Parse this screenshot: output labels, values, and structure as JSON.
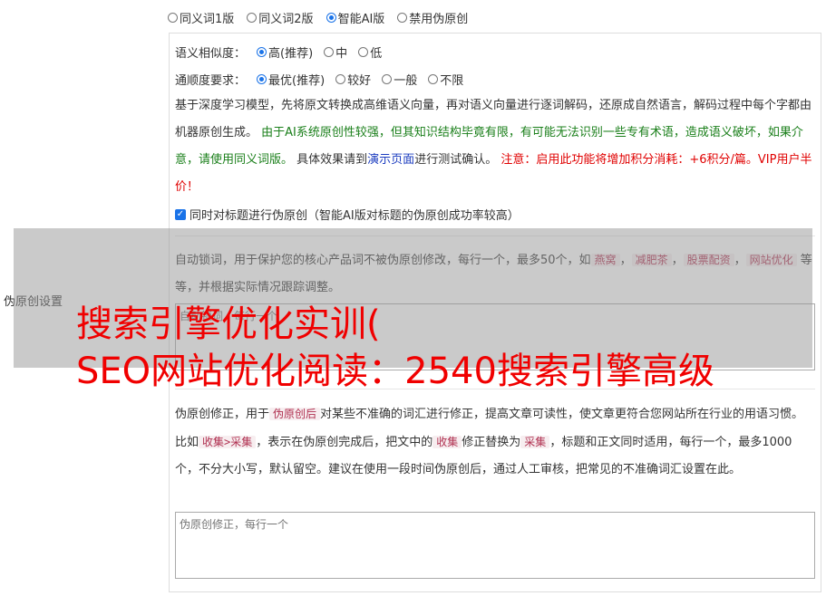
{
  "modes": {
    "options": [
      "同义词1版",
      "同义词2版",
      "智能AI版",
      "禁用伪原创"
    ],
    "selected_index": 2
  },
  "similarity": {
    "label": "语义相似度：",
    "options": [
      "高(推荐)",
      "中",
      "低"
    ],
    "selected_index": 0
  },
  "fluency": {
    "label": "通顺度要求：",
    "options": [
      "最优(推荐)",
      "较好",
      "一般",
      "不限"
    ],
    "selected_index": 0
  },
  "ai_desc": {
    "part1": "基于深度学习模型，先将原文转换成高维语义向量，再对语义向量进行逐词解码，还原成自然语言，解码过程中每个字都由机器原创生成。",
    "green": "由于AI系统原创性较强，但其知识结构毕竟有限，有可能无法识别一些专有术语，造成语义破坏，如果介意，请使用同义词版。",
    "part2": "具体效果请到",
    "link": "演示页面",
    "part3": "进行测试确认。",
    "red": "注意：启用此功能将增加积分消耗：+6积分/篇。VIP用户半价！"
  },
  "title_checkbox": {
    "label": "同时对标题进行伪原创（智能AI版对标题的伪原创成功率较高）",
    "checked": true
  },
  "lock_words": {
    "desc_start": "自动锁词，用于保护您的核心产品词不被伪原创修改，每行一个，最多50个，如",
    "examples": [
      "燕窝",
      "减肥茶",
      "股票配资",
      "网站优化"
    ],
    "comma": "，",
    "desc_end": "等等，并根据实际情况跟踪调整。",
    "placeholder": "自动锁词，每行一个"
  },
  "correction": {
    "t1": "伪原创修正，用于",
    "tag1": "伪原创后",
    "t2": "对某些不准确的词汇进行修正，提高文章可读性，使文章更符合您网站所在行业的用语习惯。比如",
    "tag2": "收集>采集",
    "t3": "，表示在伪原创完成后，把文中的",
    "tag3": "收集",
    "t4": "修正替换为",
    "tag4": "采集",
    "t5": "，标题和正文同时适用，每行一个，最多1000个，不分大小写，默认留空。建议在使用一段时间伪原创后，通过人工审核，把常见的不准确词汇设置在此。",
    "placeholder": "伪原创修正，每行一个"
  },
  "side_label": "伪原创设置",
  "watermark": {
    "line1": "搜索引擎优化实训(",
    "line2": "SEO网站优化阅读：2540搜索引擎高级"
  }
}
